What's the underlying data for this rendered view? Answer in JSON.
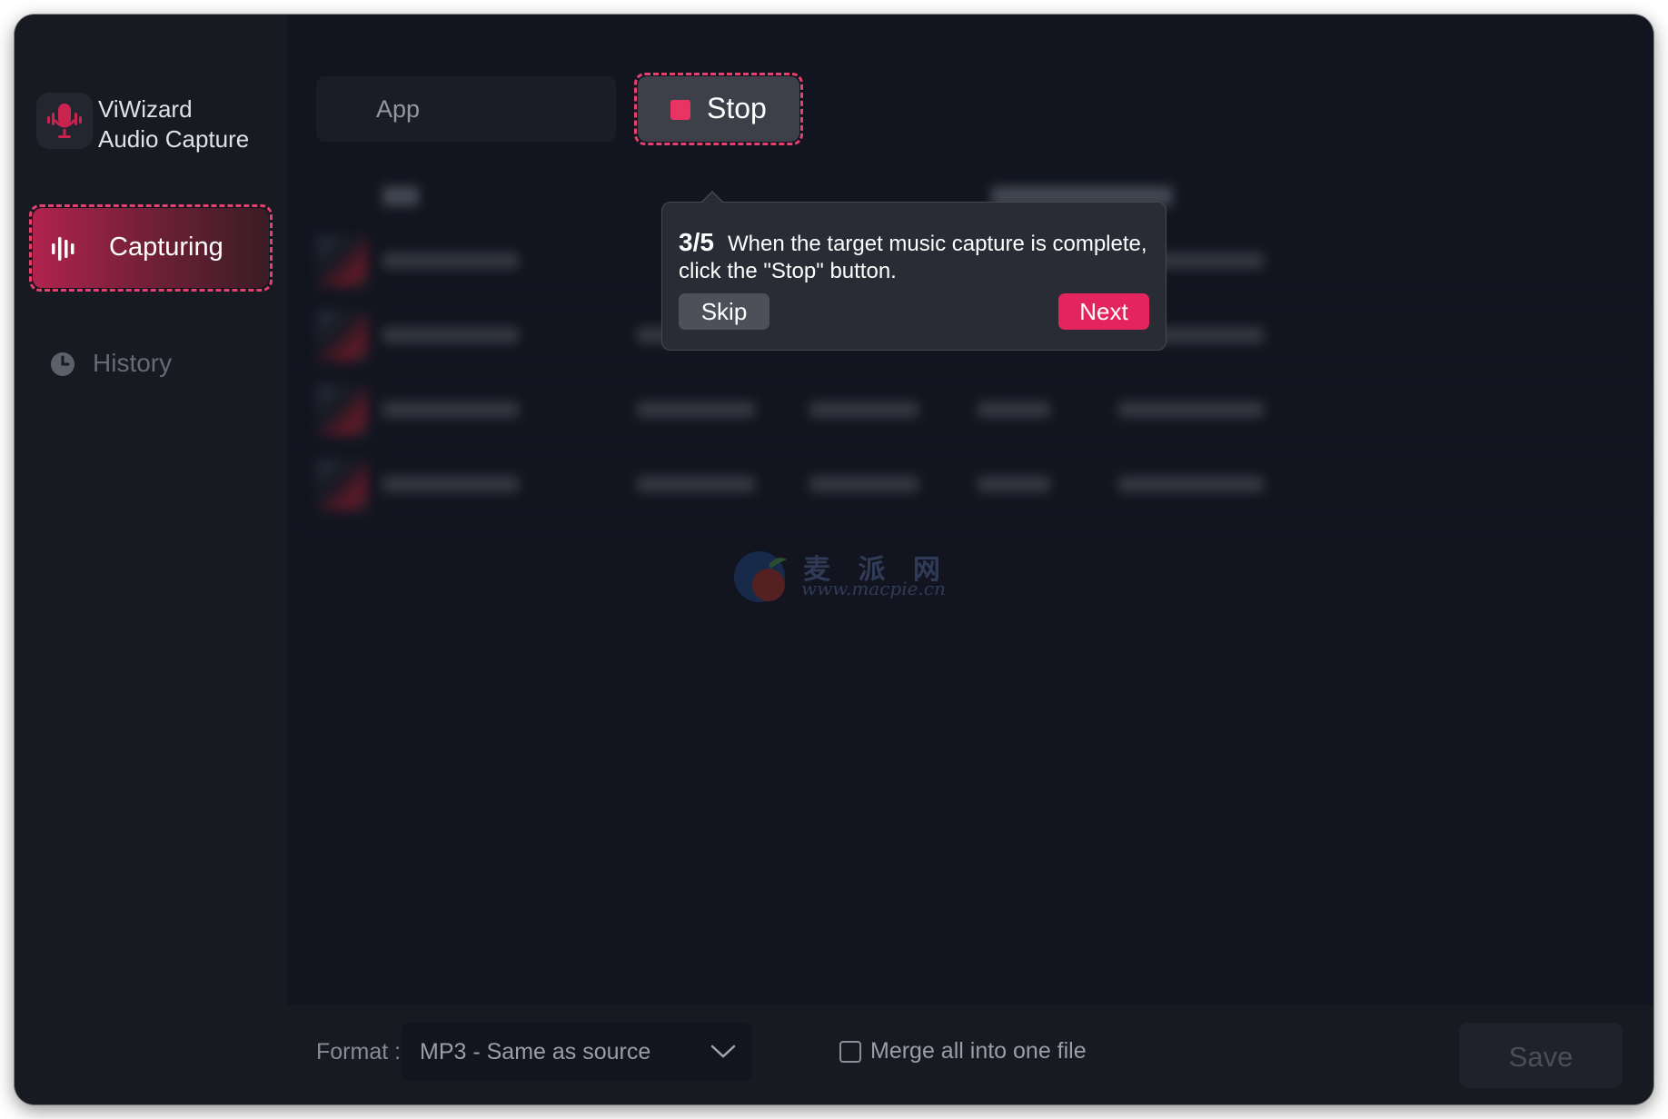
{
  "sidebar": {
    "app_name_line1": "ViWizard",
    "app_name_line2": "Audio Capture",
    "logo_icon": "microphone-icon",
    "items": [
      {
        "label": "Capturing",
        "icon": "waveform-icon",
        "active": true
      },
      {
        "label": "History",
        "icon": "clock-icon",
        "active": false
      }
    ]
  },
  "toolbar": {
    "app_label": "App",
    "stop_label": "Stop"
  },
  "tooltip": {
    "step": "3/5",
    "line1": "When the target music capture is complete,",
    "line2": "click the \"Stop\" button.",
    "skip_label": "Skip",
    "next_label": "Next"
  },
  "watermark": {
    "cn": "麦 派 网",
    "url": "www.macpie.cn"
  },
  "bottom": {
    "format_label": "Format :",
    "format_value": "MP3 - Same as source",
    "merge_label": "Merge all into one file",
    "merge_checked": false,
    "save_label": "Save"
  },
  "colors": {
    "accent": "#e3245d",
    "window_bg": "#121520",
    "sidebar_bg": "#181a22"
  }
}
